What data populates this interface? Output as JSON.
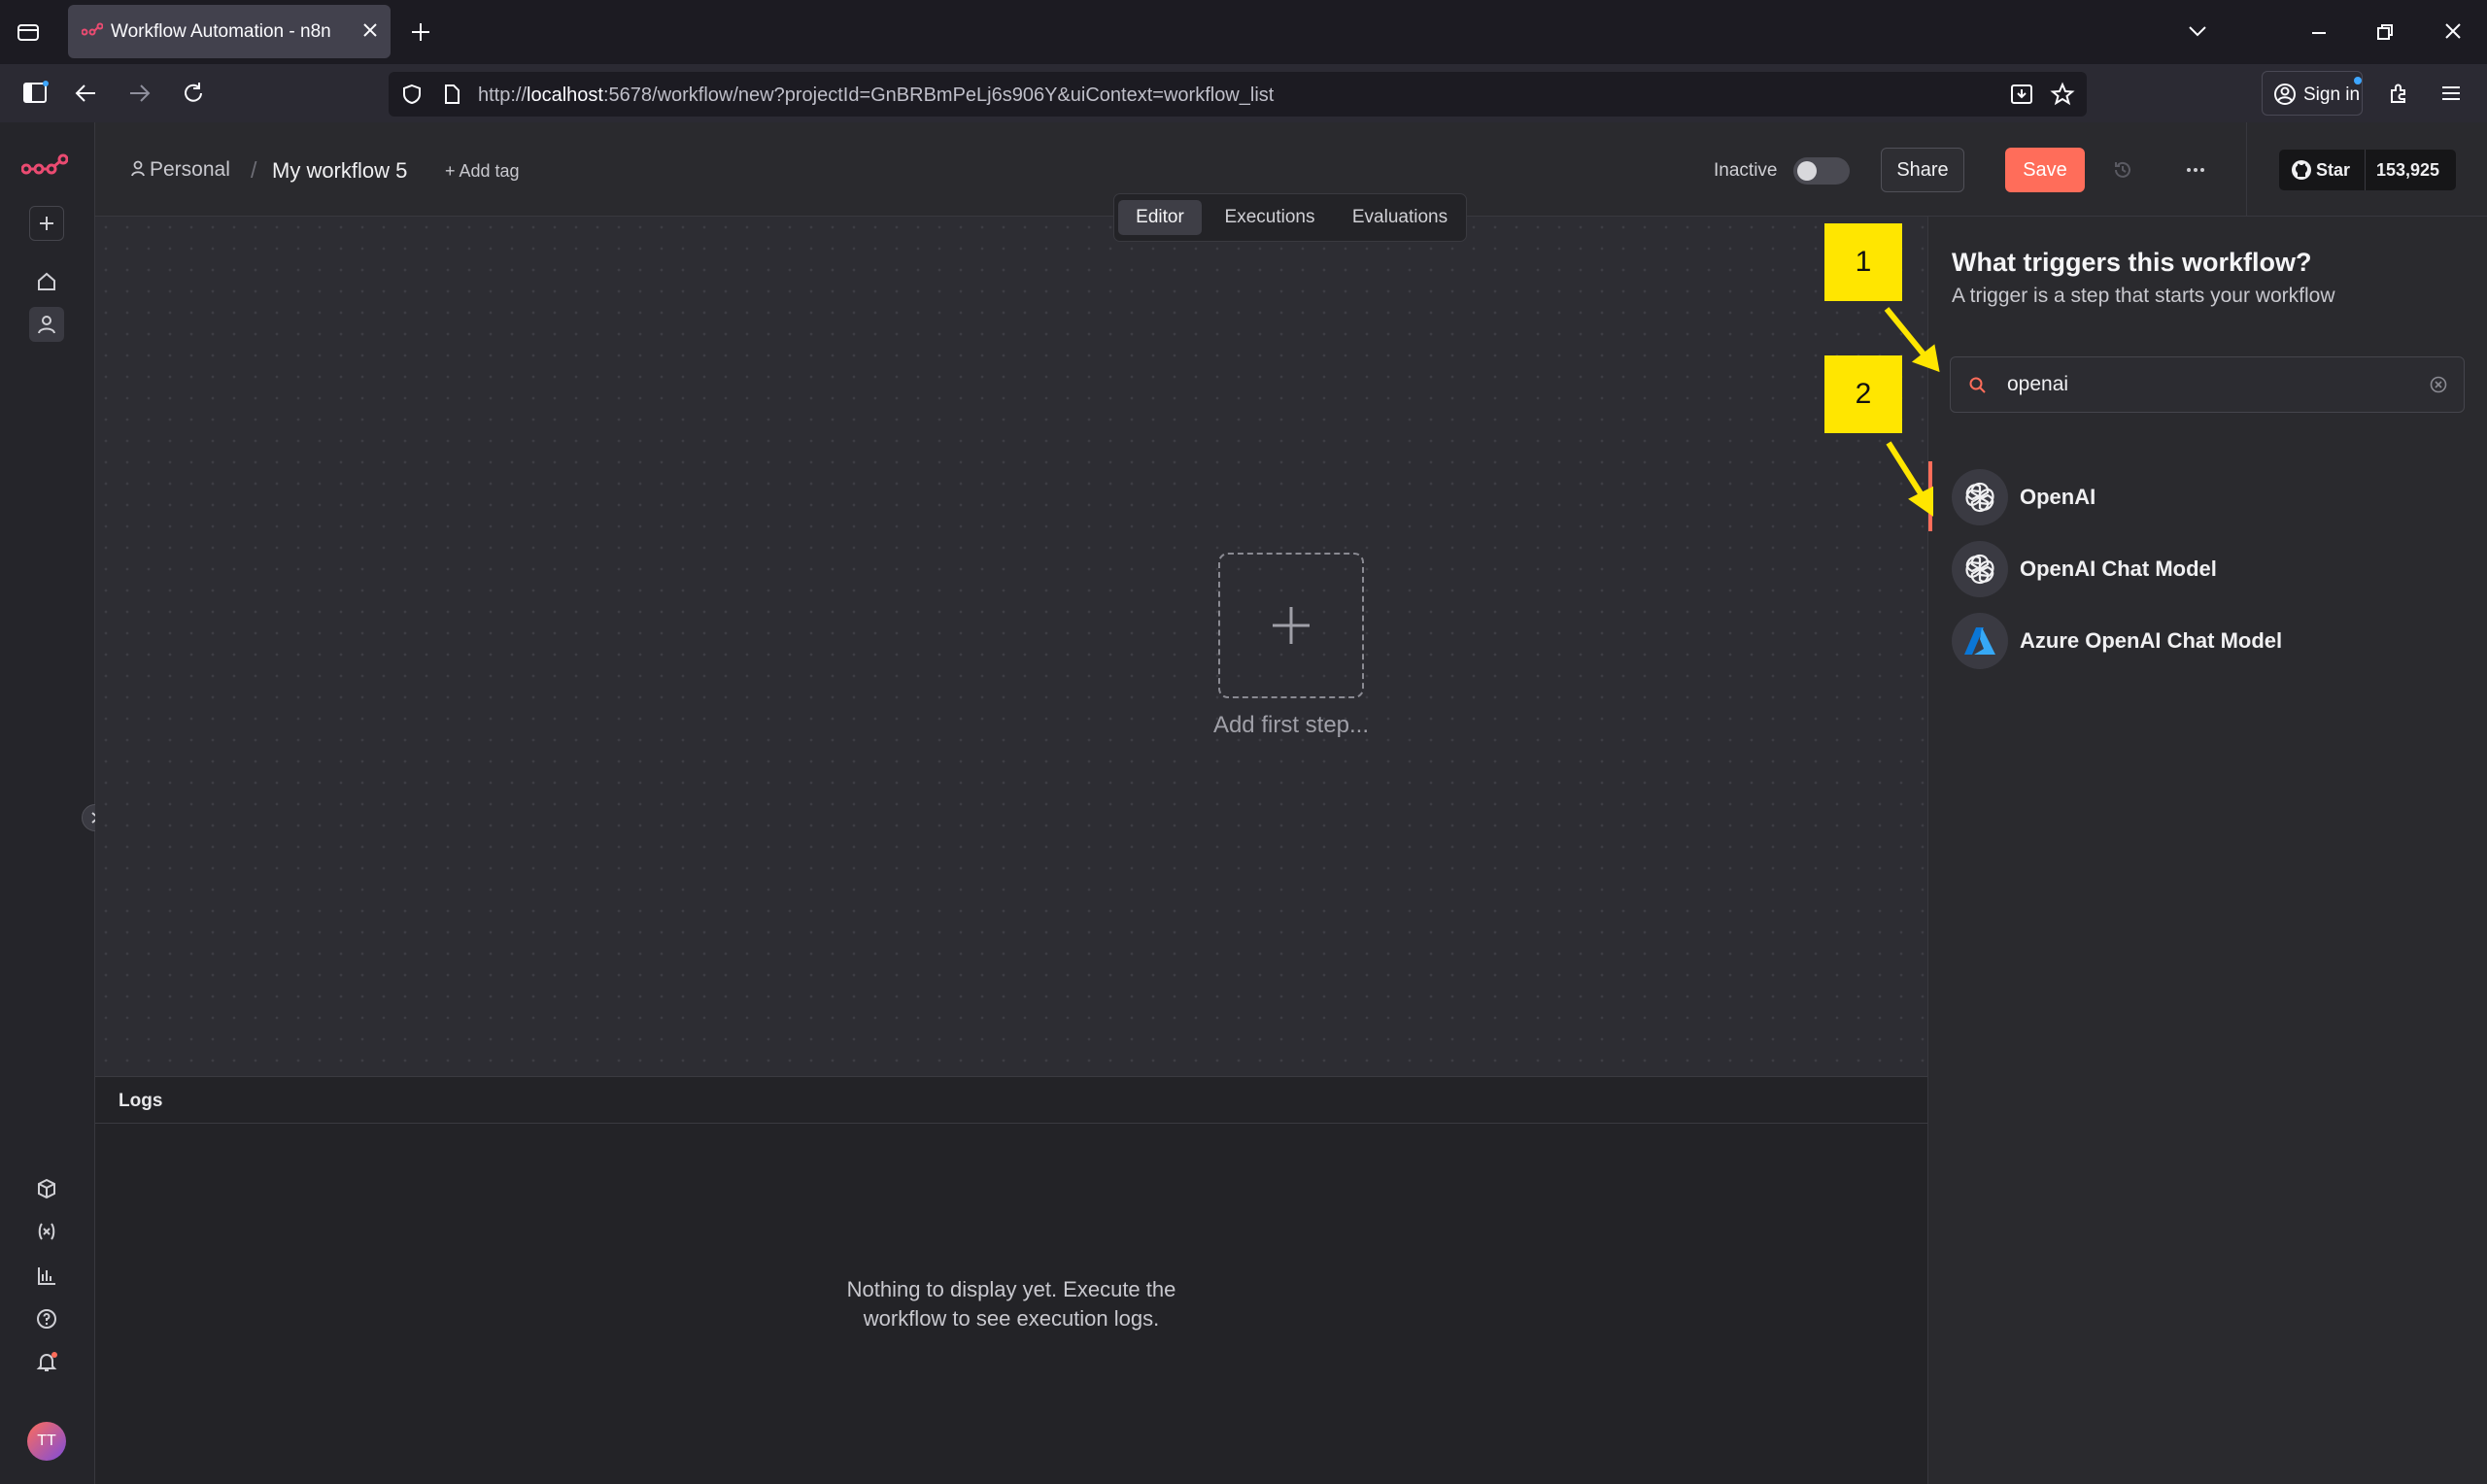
{
  "browser": {
    "tab_title": "Workflow Automation - n8n",
    "url_prefix": "http://",
    "url_host": "localhost",
    "url_rest": ":5678/workflow/new?projectId=GnBRBmPeLj6s906Y&uiContext=workflow_list",
    "signin_label": "Sign in"
  },
  "header": {
    "breadcrumb_project": "Personal",
    "breadcrumb_sep": "/",
    "workflow_name": "My workflow 5",
    "add_tag": "+ Add tag",
    "status_label": "Inactive",
    "active": false,
    "share_label": "Share",
    "save_label": "Save",
    "github_star_label": "Star",
    "github_star_count": "153,925"
  },
  "view_tabs": [
    {
      "label": "Editor",
      "selected": true
    },
    {
      "label": "Executions",
      "selected": false
    },
    {
      "label": "Evaluations",
      "selected": false
    }
  ],
  "canvas": {
    "add_first_step": "Add first step..."
  },
  "logs": {
    "title": "Logs",
    "empty_line1": "Nothing to display yet. Execute the",
    "empty_line2": "workflow to see execution logs."
  },
  "trigger_panel": {
    "title": "What triggers this workflow?",
    "subtitle": "A trigger is a step that starts your workflow",
    "search_value": "openai",
    "results": [
      {
        "name": "OpenAI",
        "icon": "openai-icon",
        "highlighted": true
      },
      {
        "name": "OpenAI Chat Model",
        "icon": "openai-icon",
        "highlighted": false
      },
      {
        "name": "Azure OpenAI Chat Model",
        "icon": "azure-icon",
        "highlighted": false
      }
    ]
  },
  "annotations": [
    {
      "label": "1"
    },
    {
      "label": "2"
    }
  ],
  "user": {
    "initials": "TT"
  },
  "colors": {
    "accent": "#ff6d5a",
    "callout": "#ffe600",
    "azure": "#0a76d6"
  }
}
